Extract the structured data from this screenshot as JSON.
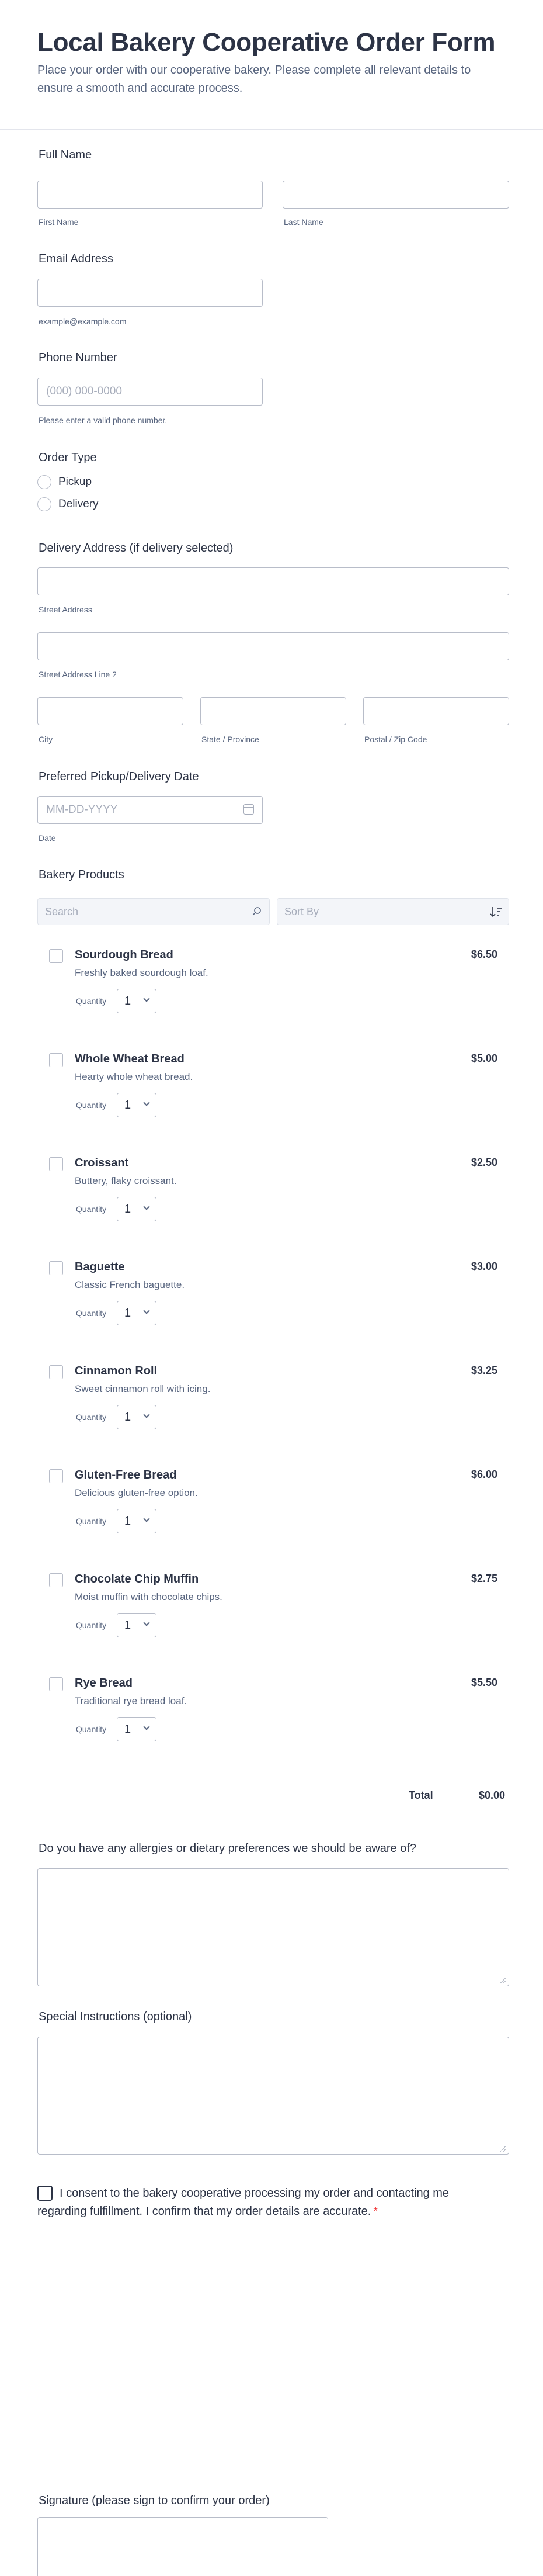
{
  "header": {
    "title": "Local Bakery Cooperative Order Form",
    "subtitle": "Place your order with our cooperative bakery. Please complete all relevant details to ensure a smooth and accurate process."
  },
  "full_name": {
    "label": "Full Name",
    "first_sublabel": "First Name",
    "last_sublabel": "Last Name",
    "first_value": "",
    "last_value": ""
  },
  "email": {
    "label": "Email Address",
    "sublabel": "example@example.com",
    "value": ""
  },
  "phone": {
    "label": "Phone Number",
    "placeholder": "(000) 000-0000",
    "sublabel": "Please enter a valid phone number."
  },
  "order_type": {
    "label": "Order Type",
    "options": [
      "Pickup",
      "Delivery"
    ]
  },
  "address": {
    "label": "Delivery Address (if delivery selected)",
    "street": "Street Address",
    "street2": "Street Address Line 2",
    "city": "City",
    "state": "State / Province",
    "zip": "Postal / Zip Code"
  },
  "date": {
    "label": "Preferred Pickup/Delivery Date",
    "placeholder": "MM-DD-YYYY",
    "sublabel": "Date",
    "icon": "calendar-icon"
  },
  "products": {
    "label": "Bakery Products",
    "search_placeholder": "Search",
    "sort_placeholder": "Sort By",
    "quantity_label": "Quantity",
    "items": [
      {
        "name": "Sourdough Bread",
        "desc": "Freshly baked sourdough loaf.",
        "price": "$6.50",
        "qty": "1"
      },
      {
        "name": "Whole Wheat Bread",
        "desc": "Hearty whole wheat bread.",
        "price": "$5.00",
        "qty": "1"
      },
      {
        "name": "Croissant",
        "desc": "Buttery, flaky croissant.",
        "price": "$2.50",
        "qty": "1"
      },
      {
        "name": "Baguette",
        "desc": "Classic French baguette.",
        "price": "$3.00",
        "qty": "1"
      },
      {
        "name": "Cinnamon Roll",
        "desc": "Sweet cinnamon roll with icing.",
        "price": "$3.25",
        "qty": "1"
      },
      {
        "name": "Gluten-Free Bread",
        "desc": "Delicious gluten-free option.",
        "price": "$6.00",
        "qty": "1"
      },
      {
        "name": "Chocolate Chip Muffin",
        "desc": "Moist muffin with chocolate chips.",
        "price": "$2.75",
        "qty": "1"
      },
      {
        "name": "Rye Bread",
        "desc": "Traditional rye bread loaf.",
        "price": "$5.50",
        "qty": "1"
      }
    ],
    "total_label": "Total",
    "total_value": "$0.00"
  },
  "allergies": {
    "label": "Do you have any allergies or dietary preferences we should be aware of?"
  },
  "instructions": {
    "label": "Special Instructions (optional)"
  },
  "consent": {
    "text": "I consent to the bakery cooperative processing my order and contacting me regarding fulfillment. I confirm that my order details are accurate.",
    "required_mark": "*"
  },
  "signature": {
    "label": "Signature (please sign to confirm your order)"
  },
  "colors": {
    "text": "#2c3345",
    "muted": "#57647e",
    "border": "#b8bdc9",
    "required": "#f23a3c"
  }
}
